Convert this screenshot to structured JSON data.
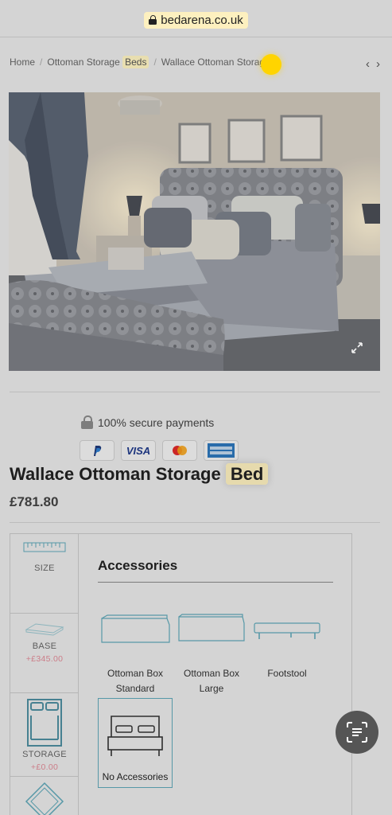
{
  "browser": {
    "url": "bedarena.co.uk"
  },
  "breadcrumb": {
    "home": "Home",
    "category_prefix": "Ottoman Storage",
    "category_highlight": "Beds",
    "current": "Wallace Ottoman Storage"
  },
  "nav": {
    "prev": "‹",
    "next": "›"
  },
  "secure_payments": {
    "text": "100% secure payments",
    "cards": [
      "PayPal",
      "VISA",
      "Mastercard",
      "American Express"
    ]
  },
  "product": {
    "title_prefix": "Wallace Ottoman Storage",
    "title_highlight": "Bed",
    "price": "£781.80"
  },
  "configurator": {
    "steps": [
      {
        "label": "SIZE",
        "price": ""
      },
      {
        "label": "BASE",
        "price": "+£345.00"
      },
      {
        "label": "STORAGE",
        "price": "+£0.00"
      }
    ],
    "panel_title": "Accessories",
    "options": [
      {
        "line1": "Ottoman Box",
        "line2": "Standard"
      },
      {
        "line1": "Ottoman Box",
        "line2": "Large"
      },
      {
        "line1": "Footstool",
        "line2": ""
      },
      {
        "line1": "No Accessories",
        "line2": ""
      }
    ],
    "selected": "No Accessories"
  },
  "colors": {
    "highlight": "#fdf0bf",
    "accent_teal": "#5fa8b8",
    "price_pink": "#e08a96",
    "cursor_yellow": "#ffd400"
  },
  "icons": [
    "lock-icon",
    "zoom-expand-icon",
    "padlock-icon",
    "visual-search-icon"
  ]
}
